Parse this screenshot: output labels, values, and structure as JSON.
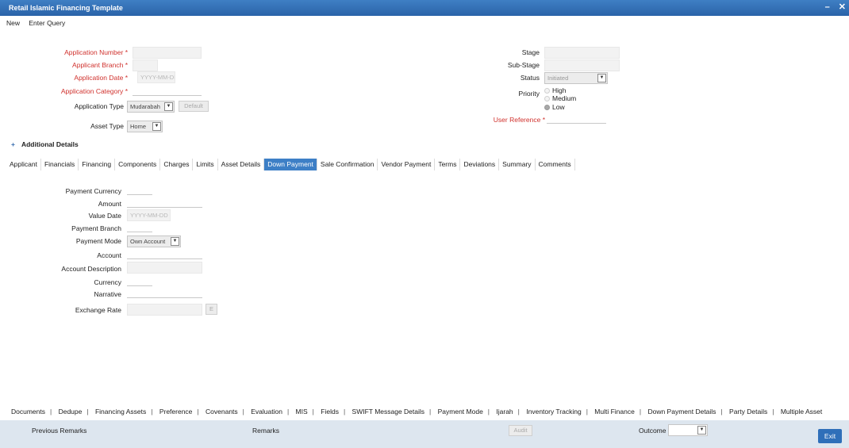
{
  "window": {
    "title": "Retail Islamic Financing Template",
    "minimize": "–",
    "close": "✕"
  },
  "menu": {
    "new": "New",
    "enter_query": "Enter Query"
  },
  "header_left": {
    "application_number": "Application Number",
    "applicant_branch": "Applicant Branch",
    "application_date": "Application Date",
    "application_date_placeholder": "YYYY-MM-DD",
    "application_category": "Application Category",
    "application_type": "Application Type",
    "application_type_value": "Mudarabah",
    "default_button": "Default",
    "asset_type": "Asset Type",
    "asset_type_value": "Home",
    "required_mark": "*"
  },
  "header_right": {
    "stage": "Stage",
    "sub_stage": "Sub-Stage",
    "status": "Status",
    "status_value": "Initiated",
    "priority": "Priority",
    "priority_options": [
      "High",
      "Medium",
      "Low"
    ],
    "priority_selected": "Low",
    "user_reference": "User Reference"
  },
  "additional_details": {
    "icon": "+",
    "label": "Additional Details"
  },
  "tabs": [
    "Applicant",
    "Financials",
    "Financing",
    "Components",
    "Charges",
    "Limits",
    "Asset Details",
    "Down Payment",
    "Sale Confirmation",
    "Vendor Payment",
    "Terms",
    "Deviations",
    "Summary",
    "Comments"
  ],
  "active_tab": "Down Payment",
  "down_payment": {
    "payment_currency": "Payment Currency",
    "amount": "Amount",
    "value_date": "Value Date",
    "value_date_placeholder": "YYYY-MM-DD",
    "payment_branch": "Payment Branch",
    "payment_mode": "Payment Mode",
    "payment_mode_value": "Own Account",
    "account": "Account",
    "account_description": "Account Description",
    "currency": "Currency",
    "narrative": "Narrative",
    "exchange_rate": "Exchange Rate",
    "exchange_rate_button": "E"
  },
  "bottom_links": [
    "Documents",
    "Dedupe",
    "Financing Assets",
    "Preference",
    "Covenants",
    "Evaluation",
    "MIS",
    "Fields",
    "SWIFT Message Details",
    "Payment Mode",
    "Ijarah",
    "Inventory Tracking",
    "Multi Finance",
    "Down Payment Details",
    "Party Details",
    "Multiple Asset"
  ],
  "footer": {
    "previous_remarks": "Previous Remarks",
    "remarks": "Remarks",
    "audit_button": "Audit",
    "outcome": "Outcome",
    "exit_button": "Exit"
  },
  "colors": {
    "title_bar": "#2f6fb9",
    "active_tab": "#3d7fc6",
    "required_label": "#d0312d",
    "footer_bg": "#dde6ef"
  }
}
